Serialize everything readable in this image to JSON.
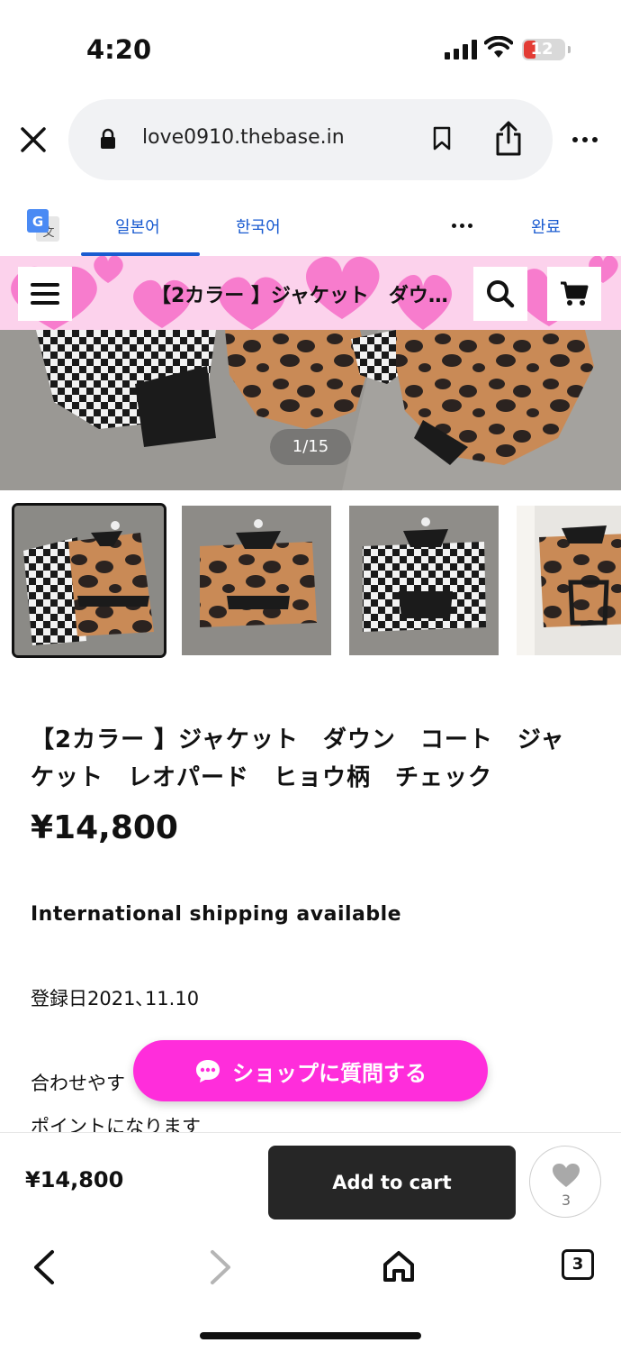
{
  "status_bar": {
    "time": "4:20",
    "battery": "12"
  },
  "browser": {
    "url": "love0910.thebase.in",
    "tabs_count": "3"
  },
  "translate_bar": {
    "tabs": [
      "일본어",
      "한국어"
    ],
    "done_label": "완료"
  },
  "shop_header": {
    "title": "【2カラー 】ジャケット　ダウ…"
  },
  "gallery": {
    "counter": "1/15"
  },
  "product": {
    "title": "【2カラー 】ジャケット　ダウン　コート　ジャケット　レオパード　ヒョウ柄　チェック",
    "price": "¥14,800",
    "shipping": "International shipping available",
    "registered": "登録日2021､11.10",
    "desc_line1": "合わせやす",
    "desc_line2": "ポイントになります"
  },
  "ask_button": {
    "label": "ショップに質問する"
  },
  "purchase_bar": {
    "price": "¥14,800",
    "add_to_cart": "Add to cart",
    "like_count": "3"
  },
  "colors": {
    "accent_pink": "#ff2ddb",
    "header_pink": "#fcd2ec",
    "link_blue": "#1a5bd0",
    "cart_dark": "#262626"
  }
}
